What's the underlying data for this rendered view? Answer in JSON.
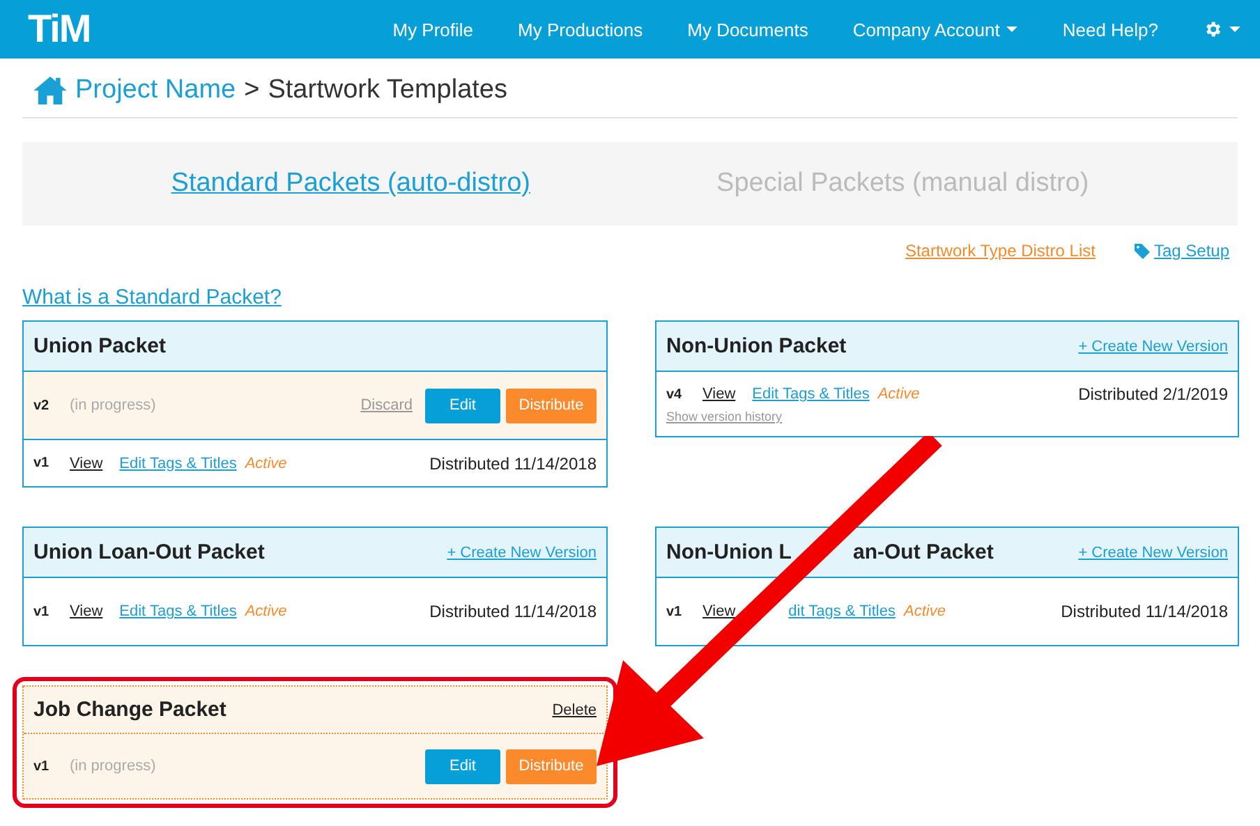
{
  "logo": "TiM",
  "nav": [
    {
      "label": "My Profile",
      "dropdown": false
    },
    {
      "label": "My Productions",
      "dropdown": false
    },
    {
      "label": "My Documents",
      "dropdown": false
    },
    {
      "label": "Company Account",
      "dropdown": true
    },
    {
      "label": "Need Help?",
      "dropdown": false
    }
  ],
  "settings_menu": {
    "dropdown": true
  },
  "breadcrumb": {
    "link": "Project Name",
    "separator": ">",
    "current": "Startwork Templates"
  },
  "tabs": [
    {
      "label": "Standard Packets (auto-distro)",
      "selected": true
    },
    {
      "label": "Special Packets (manual distro)",
      "selected": false
    }
  ],
  "top_links": [
    {
      "label": "Startwork Type Distro List",
      "kind": "plain"
    },
    {
      "label": "Tag Setup",
      "kind": "tag"
    }
  ],
  "help_link": "What is a Standard Packet?",
  "packets": [
    {
      "title": "Union Packet",
      "draft": false,
      "highlighted": false,
      "versions": [
        {
          "kind": "in_progress",
          "version": "v2",
          "status": "(in progress)",
          "discard": "Discard",
          "edit": "Edit",
          "distribute": "Distribute"
        },
        {
          "kind": "distributed",
          "version": "v1",
          "view": "View",
          "edit_tags": "Edit Tags & Titles",
          "state": "Active",
          "distributed": "Distributed 11/14/2018"
        }
      ]
    },
    {
      "title": "Non-Union Packet",
      "draft": false,
      "highlighted": false,
      "action": "+ Create New Version",
      "versions": [
        {
          "kind": "distributed",
          "version": "v4",
          "view": "View",
          "edit_tags": "Edit Tags & Titles",
          "state": "Active",
          "distributed": "Distributed 2/1/2019",
          "history": "Show version history"
        }
      ]
    },
    {
      "title": "Union Loan-Out Packet",
      "draft": false,
      "highlighted": false,
      "action": "+ Create New Version",
      "versions": [
        {
          "kind": "distributed",
          "version": "v1",
          "view": "View",
          "edit_tags": "Edit Tags & Titles",
          "state": "Active",
          "distributed": "Distributed 11/14/2018"
        }
      ]
    },
    {
      "title_parts": [
        "Non-Union L",
        "an-Out Packet"
      ],
      "draft": false,
      "highlighted": false,
      "action": "+ Create New Version",
      "versions": [
        {
          "kind": "distributed",
          "version": "v1",
          "view": "View",
          "edit_tags": "dit Tags & Titles",
          "edit_tags_cut": true,
          "state": "Active",
          "distributed": "Distributed 11/14/2018"
        }
      ]
    },
    {
      "title": "Job Change Packet",
      "draft": true,
      "highlighted": true,
      "action": "Delete",
      "versions": [
        {
          "kind": "in_progress",
          "version": "v1",
          "status": "(in progress)",
          "edit": "Edit",
          "distribute": "Distribute"
        }
      ]
    }
  ]
}
